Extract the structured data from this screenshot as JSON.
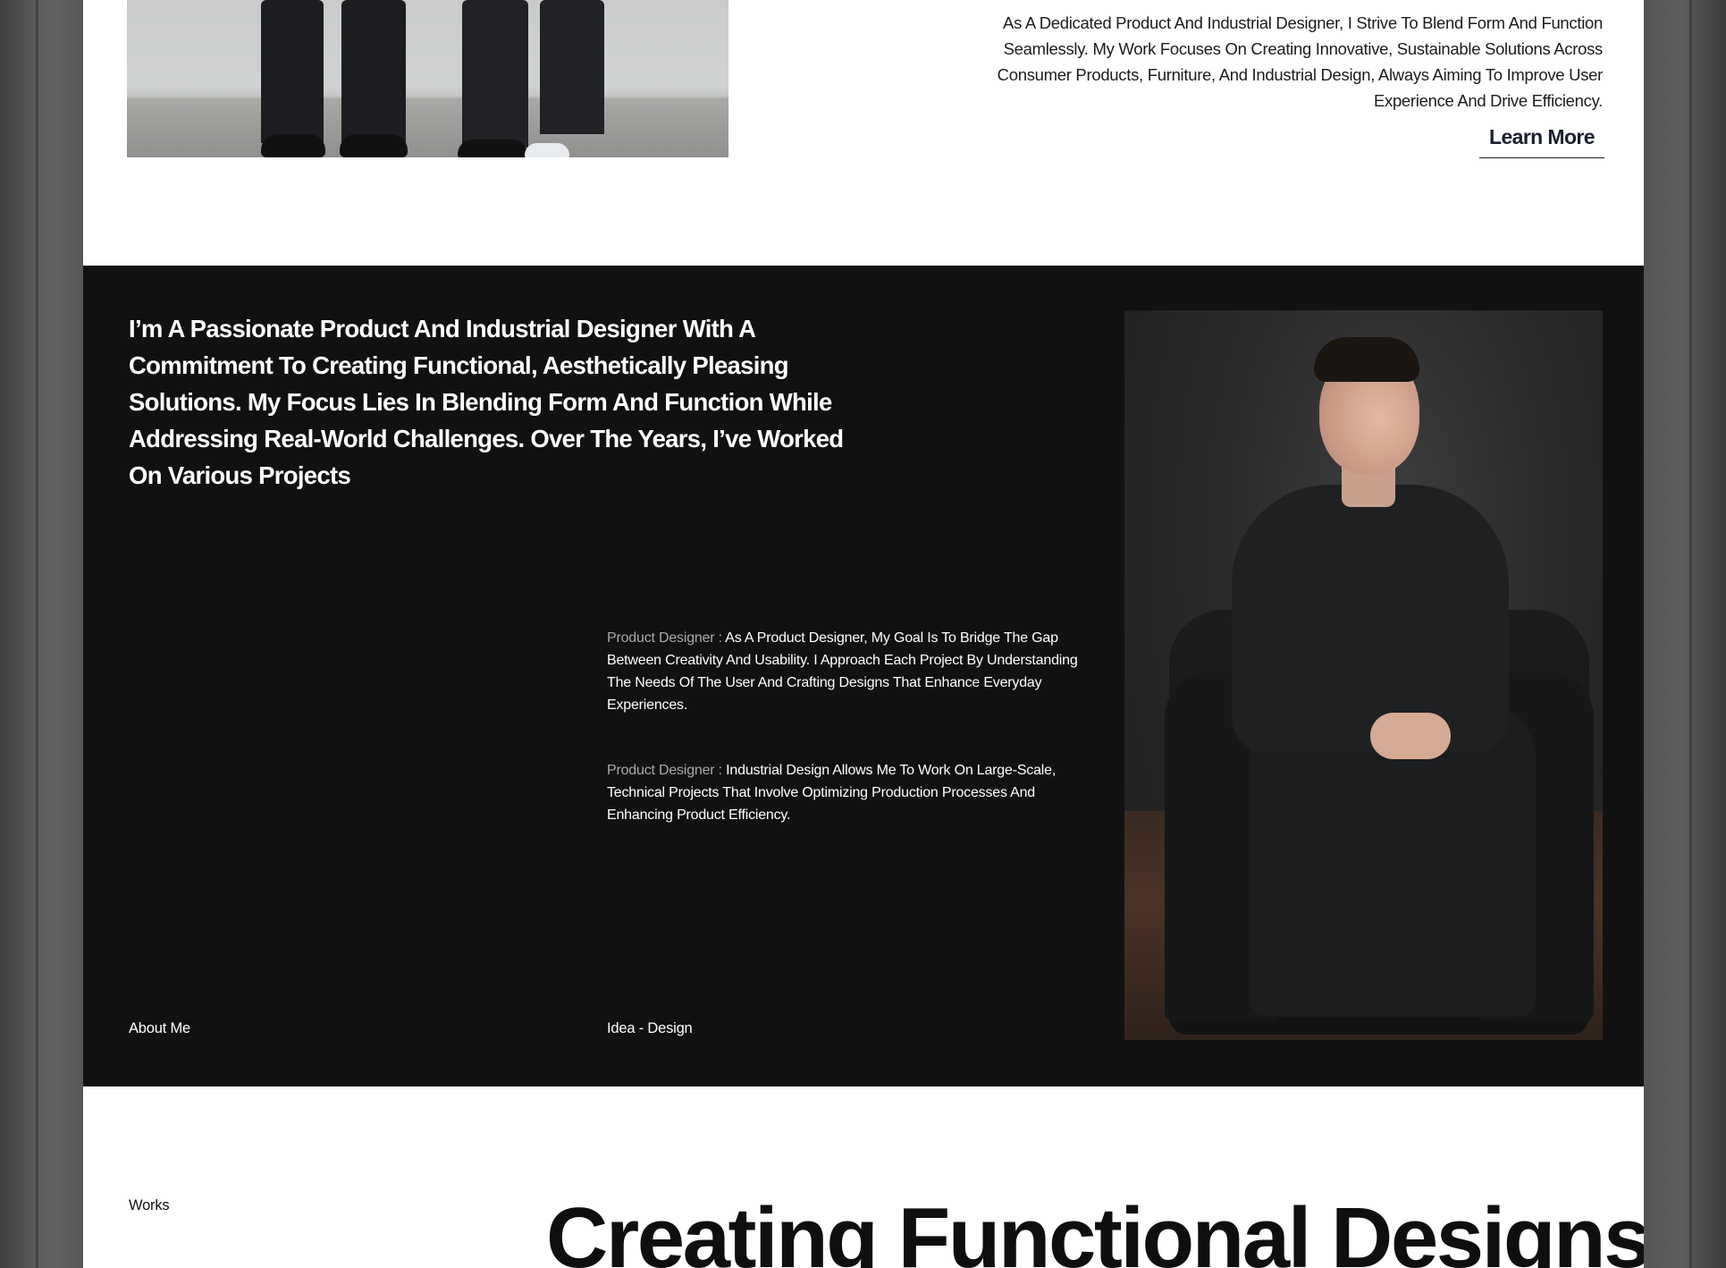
{
  "intro": {
    "paragraph": "As A Dedicated Product And Industrial Designer, I Strive To Blend Form And Function Seamlessly. My Work Focuses On Creating Innovative, Sustainable Solutions Across Consumer Products, Furniture, And Industrial Design, Always Aiming To Improve User Experience And Drive Efficiency.",
    "learn_more_label": "Learn More"
  },
  "about": {
    "heading": "I’m A Passionate Product And Industrial Designer With A Commitment To Creating Functional, Aesthetically Pleasing Solutions. My Focus Lies In Blending Form And Function While Addressing Real-World Challenges. Over The Years, I’ve Worked On Various Projects",
    "roles": [
      {
        "label": "Product Designer :",
        "text": "As A Product Designer, My Goal Is To Bridge The Gap Between Creativity And Usability. I Approach Each Project By Understanding The Needs Of The User And Crafting Designs That Enhance Everyday Experiences."
      },
      {
        "label": "Product Designer :",
        "text": "Industrial Design Allows Me To Work On Large-Scale, Technical Projects That Involve Optimizing Production Processes And Enhancing Product Efficiency."
      }
    ],
    "section_label": "About Me",
    "tagline": "Idea - Design"
  },
  "works": {
    "label": "Works",
    "title": "Creating Functional Designs"
  },
  "colors": {
    "dark_background": "#111111",
    "text_dark": "#1a1f2e",
    "role_label": "#a9a9a9"
  }
}
